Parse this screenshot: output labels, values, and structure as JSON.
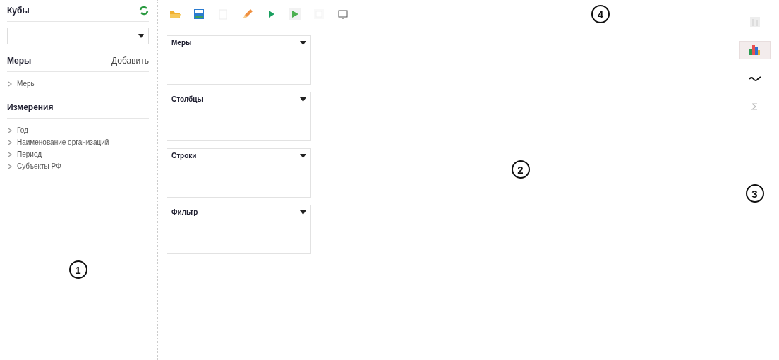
{
  "sidebar": {
    "cubes_title": "Кубы",
    "measures": {
      "title": "Меры",
      "add_label": "Добавить",
      "items": [
        {
          "label": "Меры"
        }
      ]
    },
    "dimensions": {
      "title": "Измерения",
      "items": [
        {
          "label": "Год"
        },
        {
          "label": "Наименование организаций"
        },
        {
          "label": "Период"
        },
        {
          "label": "Субъекты РФ"
        }
      ]
    },
    "callout": "1"
  },
  "toolbar": {
    "buttons": [
      {
        "kind": "folder",
        "disabled": false
      },
      {
        "kind": "save",
        "disabled": false
      },
      {
        "kind": "document",
        "disabled": true
      },
      {
        "kind": "pencil",
        "disabled": false
      },
      {
        "kind": "play",
        "disabled": false
      },
      {
        "kind": "play-box",
        "disabled": false
      },
      {
        "kind": "square",
        "disabled": true
      },
      {
        "kind": "screen",
        "disabled": false
      }
    ],
    "callout": "4"
  },
  "zones": [
    {
      "title": "Меры"
    },
    {
      "title": "Столбцы"
    },
    {
      "title": "Строки"
    },
    {
      "title": "Фильтр"
    }
  ],
  "main": {
    "callout": "2"
  },
  "chart_types": {
    "items": [
      {
        "kind": "bar",
        "selected": false
      },
      {
        "kind": "column",
        "selected": true
      },
      {
        "kind": "line",
        "selected": false
      },
      {
        "kind": "sum",
        "selected": false
      }
    ],
    "callout": "3"
  }
}
